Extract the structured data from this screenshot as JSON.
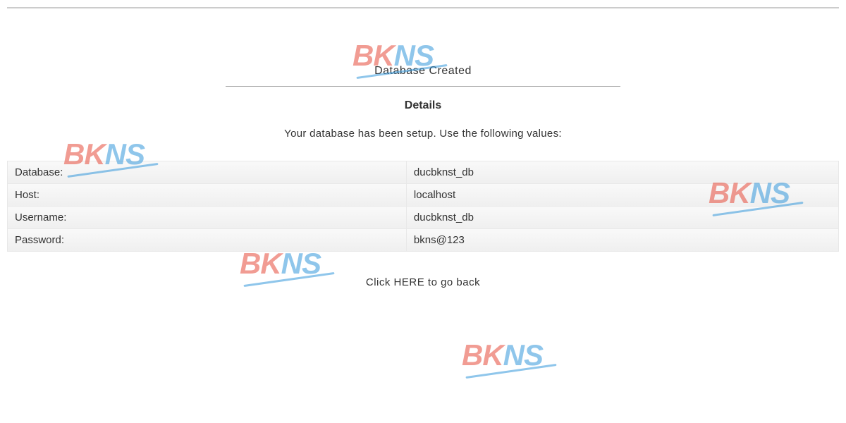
{
  "status": "Database Created",
  "heading": "Details",
  "message": "Your database has been setup. Use the following values:",
  "rows": [
    {
      "label": "Database:",
      "value": "ducbknst_db"
    },
    {
      "label": "Host:",
      "value": "localhost"
    },
    {
      "label": "Username:",
      "value": "ducbknst_db"
    },
    {
      "label": "Password:",
      "value": "bkns@123"
    }
  ],
  "back": {
    "prefix": "Click ",
    "link": "HERE",
    "suffix": " to go back"
  },
  "watermark": {
    "bk": "BK",
    "ns": "NS"
  }
}
